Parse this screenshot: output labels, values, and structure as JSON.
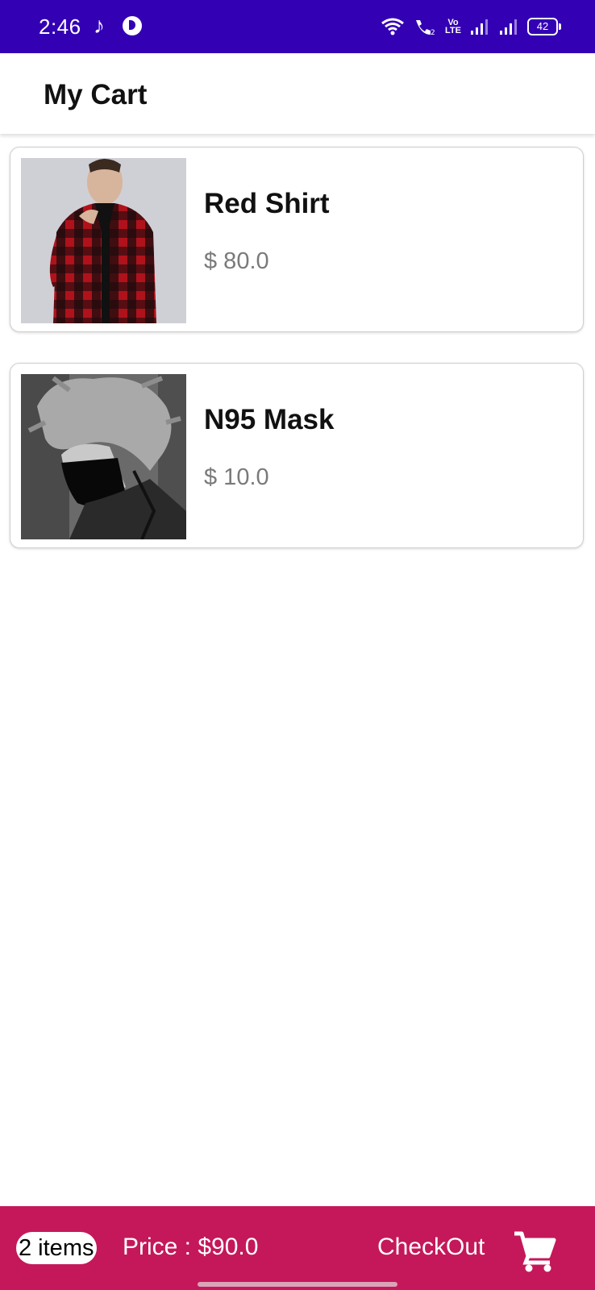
{
  "status_bar": {
    "time": "2:46",
    "battery": "42",
    "volte_line1": "Vo",
    "volte_line2": "LTE",
    "icons": [
      "music-note-icon",
      "app-notification-icon",
      "wifi-icon",
      "wifi-calling-icon",
      "volte-icon",
      "signal-icon",
      "signal-icon",
      "battery-icon"
    ]
  },
  "app_bar": {
    "title": "My Cart"
  },
  "cart": {
    "items": [
      {
        "name": "Red Shirt",
        "price": "$ 80.0",
        "image": "red-plaid-shirt-photo"
      },
      {
        "name": "N95 Mask",
        "price": "$ 10.0",
        "image": "anime-character-mask-photo"
      }
    ]
  },
  "footer": {
    "items_count": "2 items",
    "total": "Price : $90.0",
    "checkout_label": "CheckOut",
    "checkout_icon": "shopping-cart-icon"
  },
  "colors": {
    "status_bar": "#3300b4",
    "bottom_bar": "#c4185a",
    "price_text": "#7a7a7a"
  }
}
